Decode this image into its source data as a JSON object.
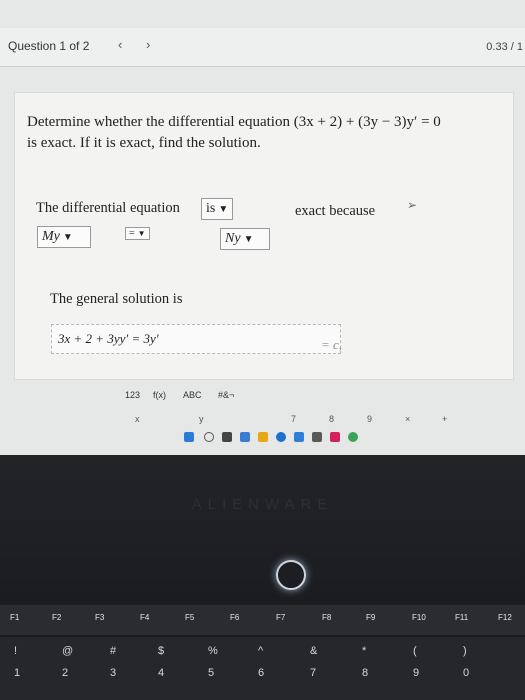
{
  "header": {
    "question_label": "Question 1 of 2",
    "prev_glyph": "‹",
    "next_glyph": "›",
    "score": "0.33 / 1"
  },
  "question": {
    "line1": "Determine whether the differential equation (3x + 2) + (3y − 3)y′ = 0",
    "line2": "is exact. If it is exact, find the solution."
  },
  "answer": {
    "stmt_label": "The differential equation",
    "is_dropdown": "is",
    "exact_because": "exact because",
    "my_dropdown": "My",
    "eq_dropdown": "=",
    "ny_dropdown": "Ny",
    "general_label": "The general solution is",
    "solution_value": "3x + 2 + 3yy′ = 3y′",
    "equals_c": "= c,"
  },
  "keyboard": {
    "tabs": [
      "123",
      "f(x)",
      "ABC",
      "#&¬"
    ],
    "keys": [
      "x",
      "y",
      "7",
      "8",
      "9",
      "×",
      "+"
    ]
  },
  "laptop": {
    "brand": "ALIENWARE",
    "fkeys": [
      "F1",
      "F2",
      "F3",
      "F4",
      "F5",
      "F6",
      "F7",
      "F8",
      "F9",
      "F10",
      "F11",
      "F12"
    ],
    "num_top": [
      "!",
      "@",
      "#",
      "$",
      "%",
      "^",
      "&",
      "*",
      "(",
      ")"
    ],
    "num_bottom": [
      "1",
      "2",
      "3",
      "4",
      "5",
      "6",
      "7",
      "8",
      "9",
      "0"
    ]
  },
  "colors": {
    "screen_bg": "#e6e7e7",
    "card_bg": "#f3f3f2",
    "laptop_bg": "#1b1d20"
  }
}
